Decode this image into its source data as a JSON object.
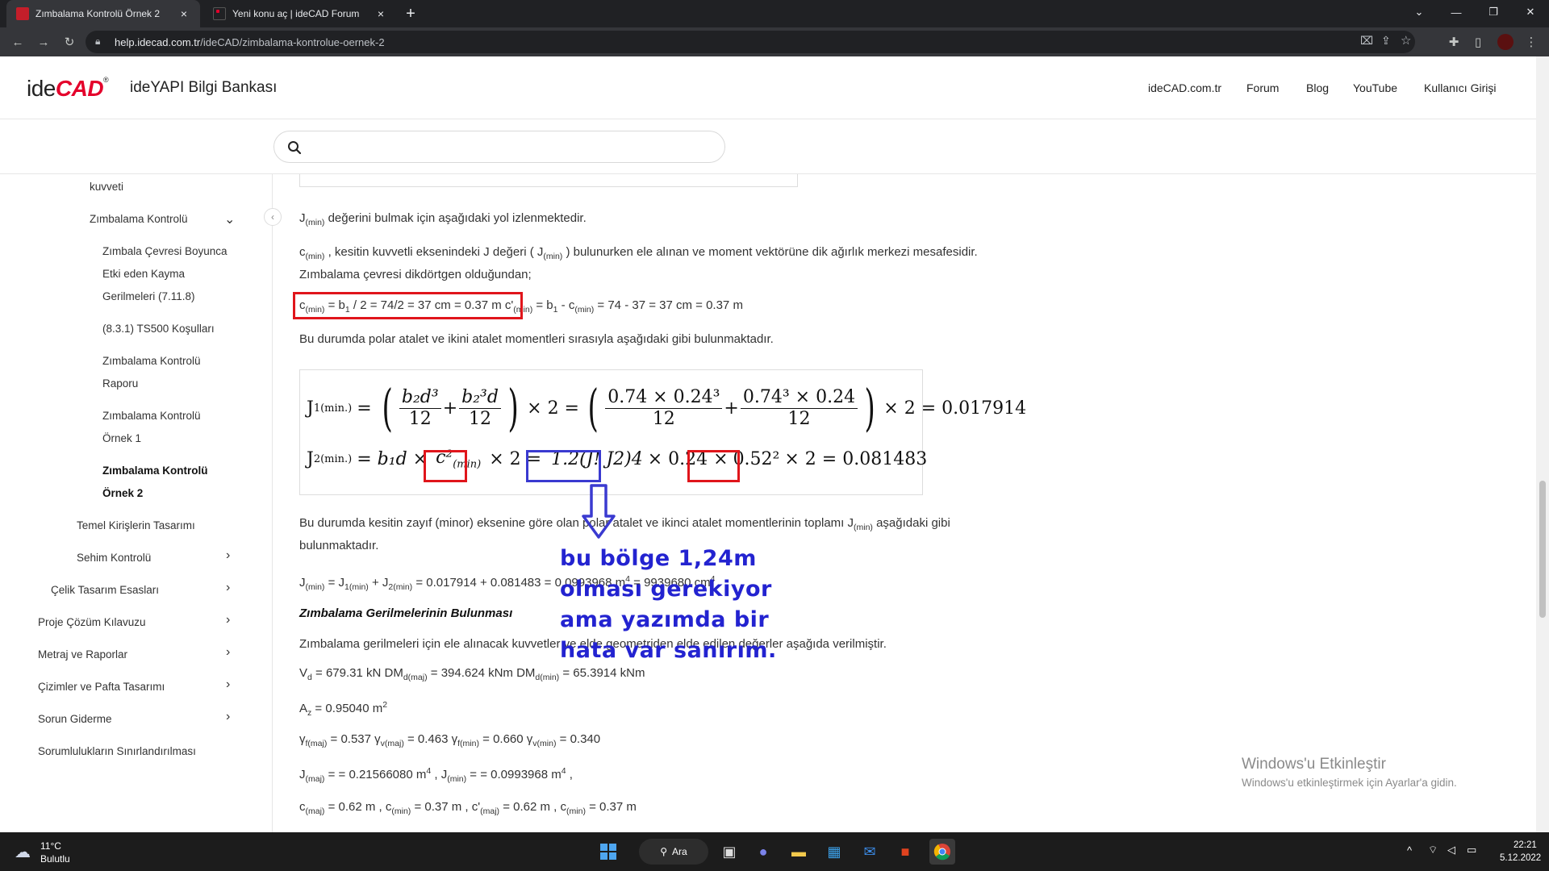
{
  "browser": {
    "tabs": [
      {
        "title": "Zımbalama Kontrolü Örnek 2",
        "active": true
      },
      {
        "title": "Yeni konu aç | ideCAD Forum",
        "active": false
      }
    ],
    "close_glyph": "×",
    "new_tab_glyph": "+",
    "url_host": "help.idecad.com.tr",
    "url_path": "/ideCAD/zimbalama-kontrolue-oernek-2"
  },
  "site": {
    "logo_ide": "ide",
    "logo_cad": "CAD",
    "brand": "ideYAPI Bilgi Bankası",
    "nav": [
      "ideCAD.com.tr",
      "Forum",
      "Blog",
      "YouTube",
      "Kullanıcı Girişi"
    ]
  },
  "sidebar": {
    "items": [
      {
        "label": "kuvveti"
      },
      {
        "label": "Zımbalama Kontrolü"
      },
      {
        "label": "Zımbala Çevresi Boyunca"
      },
      {
        "label": "Etki eden Kayma"
      },
      {
        "label": "Gerilmeleri (7.11.8)"
      },
      {
        "label": "(8.3.1) TS500 Koşulları"
      },
      {
        "label": "Zımbalama Kontrolü"
      },
      {
        "label": "Raporu"
      },
      {
        "label": "Zımbalama Kontrolü"
      },
      {
        "label": "Örnek 1"
      },
      {
        "label": "Zımbalama Kontrolü"
      },
      {
        "label": "Örnek 2"
      },
      {
        "label": "Temel Kirişlerin Tasarımı"
      },
      {
        "label": "Sehim Kontrolü"
      },
      {
        "label": "Çelik Tasarım Esasları"
      },
      {
        "label": "Proje Çözüm Kılavuzu"
      },
      {
        "label": "Metraj ve Raporlar"
      },
      {
        "label": "Çizimler ve Pafta Tasarımı"
      },
      {
        "label": "Sorun Giderme"
      },
      {
        "label": "Sorumlulukların Sınırlandırılması"
      }
    ]
  },
  "content": {
    "p1": {
      "a": "J",
      "b": "(min)",
      "c": " değerini bulmak için aşağıdaki yol izlenmektedir."
    },
    "p2": {
      "a": "c",
      "b": "(min)",
      "c": " , kesitin kuvvetli eksenindeki J değeri ( J",
      "d": "(min)",
      "e": " ) bulunurken ele alınan ve moment vektörüne dik ağırlık merkezi mesafesidir."
    },
    "p3": "Zımbalama çevresi dikdörtgen olduğundan;",
    "p4": {
      "a": "c",
      "b": "(min)",
      "c": " = b",
      "d": "1",
      "e": " / 2 = 74/2 = 37 cm = 0.37 m",
      "f": "c'",
      "g": "(min)",
      "h": " = b",
      "i": "1",
      "j": " - c",
      "k": "(min)",
      "l": " = 74 - 37 = 37 cm = 0.37 m"
    },
    "p5": "Bu durumda polar atalet ve ikini atalet momentleri sırasıyla aşağıdaki gibi bulunmaktadır.",
    "formula": {
      "j1_label": "J",
      "j1_sub": "1(min.)",
      "b2d3": "b₂d³",
      "b2cube_d": "b₂³d",
      "twelve": "12",
      "n1": "0.74 × 0.24³",
      "n2": "0.74³ × 0.24",
      "times2": "× 2 =",
      "r1": "× 2 = 0.017914",
      "j2_label": "J",
      "j2_sub": "2(min.)",
      "b1d": "= b₁d ×",
      "c2min": "c²",
      "c2min_sub": "(min)",
      "mid": "1.2(J! J2)4",
      "m2": "× 0.24 ×",
      "p052": "0.52²",
      "r2": "× 2 = 0.081483"
    },
    "p6a": {
      "a": "Bu durumda kesitin zayıf (minor) eksenine göre olan polar atalet ve ikinci atalet momentlerinin toplamı J",
      "b": "(min)",
      "c": " aşağıdaki gibi"
    },
    "p6b": "bulunmaktadır.",
    "p7": {
      "a": "J",
      "b": "(min)",
      "c": " = J",
      "d": "1(min)",
      "e": " + J",
      "f": "2(min)",
      "g": " = 0.017914 + 0.081483 = 0.0993968 m",
      "h": "4",
      "i": " = 9939680 cm",
      "j": "4"
    },
    "h_stress": "Zımbalama Gerilmelerinin Bulunması",
    "p8": "Zımbalama gerilmeleri için ele alınacak kuvvetler ve elde geometriden elde edilen değerler aşağıda verilmiştir.",
    "p9": {
      "a": "V",
      "b": "d",
      "c": " = 679.31 kN DM",
      "d": "d(maj)",
      "e": " = 394.624 kNm DM",
      "f": "d(min)",
      "g": " = 65.3914 kNm"
    },
    "p10": {
      "a": "A",
      "b": "z",
      "c": " = 0.95040 m",
      "d": "2"
    },
    "p11": {
      "a": "γ",
      "b": "f(maj)",
      "c": " = 0.537 γ",
      "d": "v(maj)",
      "e": " = 0.463 γ",
      "f": "f(min)",
      "g": " = 0.660 γ",
      "h": "v(min)",
      "i": " = 0.340"
    },
    "p12": {
      "a": "J",
      "b": "(maj)",
      "c": " = = 0.21566080 m",
      "d": "4",
      "e": " , J",
      "f": "(min)",
      "g": " = = 0.0993968 m",
      "h": "4",
      "i": " ,"
    },
    "p13": {
      "a": "c",
      "b": "(maj)",
      "c": " = 0.62 m , c",
      "d": "(min)",
      "e": " = 0.37 m , c'",
      "f": "(maj)",
      "g": " = 0.62 m , c",
      "h": "(min)",
      "i": " = 0.37 m"
    }
  },
  "annotation": {
    "lines": [
      "bu bölge 1,24m",
      "olması gerekiyor",
      "ama yazımda bir",
      "hata var sanırım."
    ]
  },
  "watermark": {
    "title": "Windows'u Etkinleştir",
    "subtitle": "Windows'u etkinleştirmek için Ayarlar'a gidin."
  },
  "taskbar": {
    "weather_temp": "11°C",
    "weather_desc": "Bulutlu",
    "search_label": "Ara",
    "time": "22:21",
    "date": "5.12.2022"
  },
  "colors": {
    "annotation_red": "#e0151b",
    "annotation_blue": "#3a3ad0",
    "brand_red": "#e4002b"
  }
}
